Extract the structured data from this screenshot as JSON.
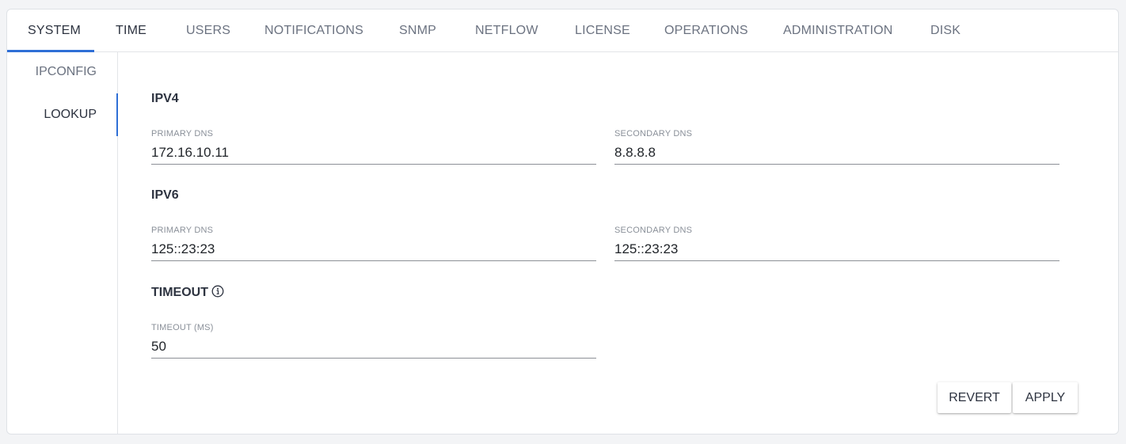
{
  "tabs": [
    {
      "label": "SYSTEM",
      "active": true
    },
    {
      "label": "TIME"
    },
    {
      "label": "USERS"
    },
    {
      "label": "NOTIFICATIONS"
    },
    {
      "label": "SNMP"
    },
    {
      "label": "NETFLOW"
    },
    {
      "label": "LICENSE"
    },
    {
      "label": "OPERATIONS"
    },
    {
      "label": "ADMINISTRATION"
    },
    {
      "label": "DISK"
    }
  ],
  "sidenav": {
    "items": [
      {
        "label": "IPCONFIG"
      },
      {
        "label": "LOOKUP",
        "active": true
      }
    ]
  },
  "ipv4": {
    "title": "IPV4",
    "primary_label": "PRIMARY DNS",
    "primary_value": "172.16.10.11",
    "secondary_label": "SECONDARY DNS",
    "secondary_value": "8.8.8.8"
  },
  "ipv6": {
    "title": "IPV6",
    "primary_label": "PRIMARY DNS",
    "primary_value": "125::23:23",
    "secondary_label": "SECONDARY DNS",
    "secondary_value": "125::23:23"
  },
  "timeout": {
    "title": "TIMEOUT",
    "info_icon": "info-circle-icon",
    "label": "TIMEOUT (MS)",
    "value": "50"
  },
  "actions": {
    "revert_label": "REVERT",
    "apply_label": "APPLY"
  },
  "colors": {
    "accent": "#2f6fd6"
  }
}
